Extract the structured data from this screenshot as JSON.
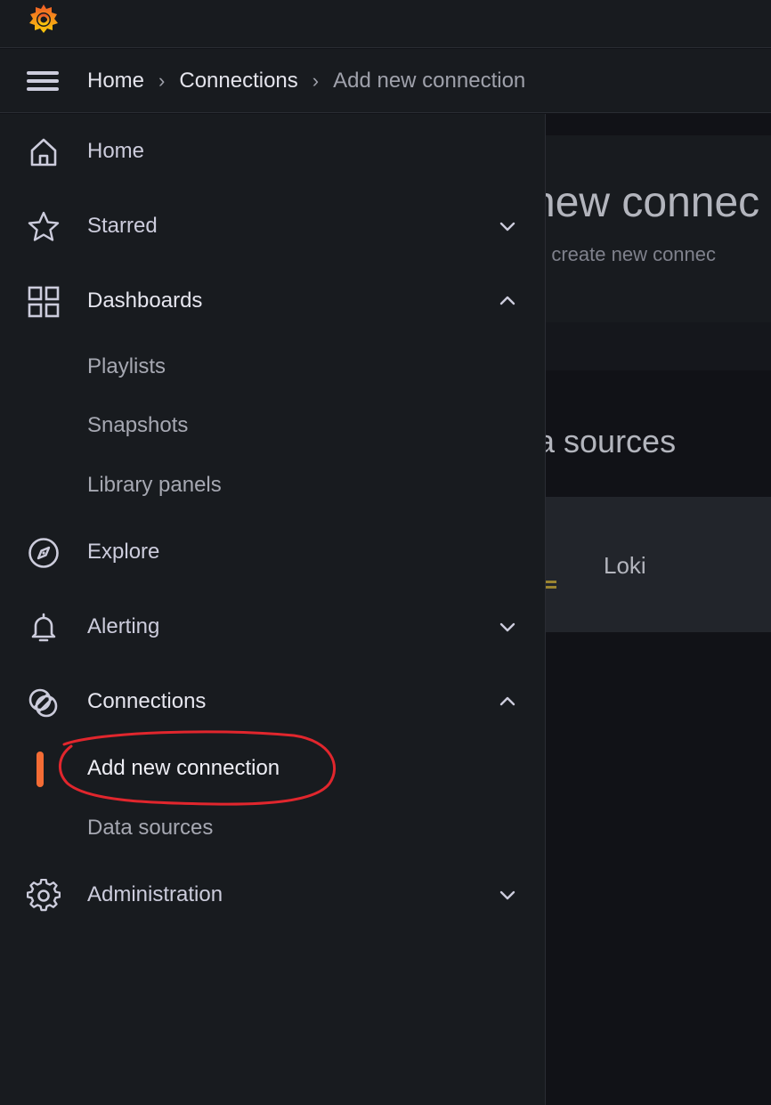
{
  "breadcrumb": {
    "items": [
      "Home",
      "Connections",
      "Add new connection"
    ],
    "separator": "›"
  },
  "page": {
    "title": "new connec",
    "subtitle": "d create new connec",
    "section_title": "a sources",
    "card_label": "Loki"
  },
  "sidemenu": {
    "home": "Home",
    "starred": "Starred",
    "dashboards": "Dashboards",
    "dashboards_children": [
      "Playlists",
      "Snapshots",
      "Library panels"
    ],
    "explore": "Explore",
    "alerting": "Alerting",
    "connections": "Connections",
    "connections_children": [
      "Add new connection",
      "Data sources"
    ],
    "administration": "Administration"
  },
  "colors": {
    "accent": "#f46c35",
    "annotation": "#e1262d",
    "logo_primary": "#f05a28",
    "logo_secondary": "#fbca0a"
  }
}
